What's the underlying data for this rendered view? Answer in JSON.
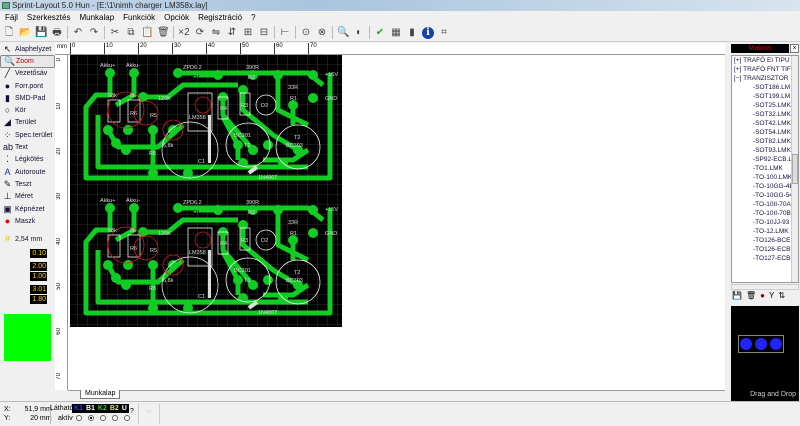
{
  "window": {
    "title": "Sprint-Layout 5.0 Hun    - [E:\\1\\nimh charger LM358x.lay]"
  },
  "menu": [
    "Fájl",
    "Szerkesztés",
    "Munkalap",
    "Funkciók",
    "Opciók",
    "Regisztráció",
    "?"
  ],
  "toolbar": {
    "icons": [
      "new-icon",
      "open-icon",
      "save-icon",
      "print-icon",
      "undo-icon",
      "redo-icon",
      "cut-icon",
      "copy-icon",
      "paste-icon",
      "delete-icon",
      "duplicate-icon",
      "rotate-icon",
      "mirror-h-icon",
      "mirror-v-icon",
      "group-icon",
      "ungroup-icon",
      "align-icon",
      "mask-icon",
      "lock-icon",
      "zoom-icon",
      "contrast-icon",
      "drc-icon",
      "components-icon",
      "stop-icon",
      "info-icon",
      "crop-icon"
    ],
    "x2": "×2"
  },
  "tools": [
    {
      "label": "Alaphelyzet",
      "icon": "pointer-icon"
    },
    {
      "label": "Zoom",
      "icon": "zoom-icon",
      "active": true
    },
    {
      "label": "Vezetősáv",
      "icon": "track-icon"
    },
    {
      "label": "Forr.pont",
      "icon": "pad-icon"
    },
    {
      "label": "SMD-Pad",
      "icon": "smd-pad-icon"
    },
    {
      "label": "Kör",
      "icon": "circle-icon"
    },
    {
      "label": "Terület",
      "icon": "area-icon"
    },
    {
      "label": "Spec.terület",
      "icon": "special-area-icon"
    },
    {
      "label": "Text",
      "icon": "text-icon"
    },
    {
      "label": "Légkötés",
      "icon": "airwire-icon"
    },
    {
      "label": "Autoroute",
      "icon": "autoroute-icon"
    },
    {
      "label": "Teszt",
      "icon": "test-icon"
    },
    {
      "label": "Méret",
      "icon": "measure-icon"
    },
    {
      "label": "Képnézet",
      "icon": "photo-view-icon"
    },
    {
      "label": "Maszk",
      "icon": "mask-icon"
    }
  ],
  "grid": {
    "label": "2,54 mm"
  },
  "values": {
    "track_width": "0.10",
    "pad_outer": "2.00",
    "pad_inner": "1.00",
    "smd_w": "3.01",
    "smd_h": "1.80"
  },
  "color_swatch": "#00ff00",
  "ruler": {
    "unit": "mm",
    "h_ticks": [
      "0",
      "10",
      "20",
      "30",
      "40",
      "50",
      "60",
      "70"
    ],
    "v_ticks": [
      "0",
      "10",
      "20",
      "30",
      "40",
      "50",
      "60",
      "70"
    ]
  },
  "pcb": {
    "labels": {
      "akku_plus": "Akku+",
      "akku_minus": "Akku-",
      "zpd": "ZPD6.2",
      "d1": "D1",
      "r390": "390R",
      "r2": "R2",
      "v15": "+15V",
      "gnd": "GND",
      "r33": "33R",
      "r1": "R1",
      "k68": "68k",
      "k8": "8k",
      "k120": "120K",
      "r5": "R5",
      "r6": "R6",
      "r4": "R4",
      "r3": "R3",
      "ic": "LM358",
      "bc301": "BC301",
      "bc303": "BC303",
      "t1": "T1",
      "t2": "T2",
      "d2": "D2",
      "c1": "C1",
      "r8": "R8",
      "k68b": "6,8k",
      "diode": "1N4007"
    }
  },
  "tab": {
    "label": "Munkalap"
  },
  "status": {
    "x_label": "X:",
    "x_value": "51,9 mm",
    "y_label": "Y:",
    "y_value": "20 mm",
    "visible_label": "Látható",
    "active_label": "aktív",
    "layers": [
      {
        "name": "K1",
        "color": "#3333ff"
      },
      {
        "name": "B1",
        "color": "#ffffff"
      },
      {
        "name": "K2",
        "color": "#33cc33"
      },
      {
        "name": "B2",
        "color": "#dddd66"
      },
      {
        "name": "U",
        "color": "#ffffff"
      }
    ],
    "help": "?",
    "active_layer": 1
  },
  "macros": {
    "title": "Makros",
    "close": "×",
    "tree": [
      {
        "label": "TRAFÓ EI TIPU",
        "type": "parent",
        "sign": "+"
      },
      {
        "label": "TRAFÓ FNT TIF",
        "type": "parent",
        "sign": "+"
      },
      {
        "label": "TRANZISZTOR",
        "type": "parent",
        "sign": "−"
      },
      {
        "label": "SOT186.LM"
      },
      {
        "label": "SOT199.LM"
      },
      {
        "label": "SOT25.LMK"
      },
      {
        "label": "SOT32.LMK"
      },
      {
        "label": "SOT42.LMK"
      },
      {
        "label": "SOT54.LMK"
      },
      {
        "label": "SOT82.LMK"
      },
      {
        "label": "SOT93.LMK"
      },
      {
        "label": "SP92-ECB.L"
      },
      {
        "label": "TO1.LMK"
      },
      {
        "label": "TO-100.LMK"
      },
      {
        "label": "TO-10GG-4E"
      },
      {
        "label": "TO-10GG-54"
      },
      {
        "label": "TO-10II-70A"
      },
      {
        "label": "TO-10II-70B"
      },
      {
        "label": "TO-10JJ-93"
      },
      {
        "label": "TO-12.LMK"
      },
      {
        "label": "TO126-BCE"
      },
      {
        "label": "TO126-ECB"
      },
      {
        "label": "TO127-ECB"
      }
    ],
    "actions": [
      "save-icon",
      "delete-icon",
      "record-icon",
      "split-icon",
      "sort-icon"
    ],
    "preview_caption": "Drag and Drop"
  }
}
